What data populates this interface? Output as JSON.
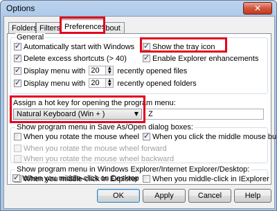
{
  "window": {
    "title": "Options",
    "close_glyph": "✕"
  },
  "tabs": [
    {
      "label": "Folders"
    },
    {
      "label": "Filters"
    },
    {
      "label": "Preferences"
    },
    {
      "label": "About"
    }
  ],
  "general": {
    "title": "General",
    "auto_start": {
      "label": "Automatically start with Windows",
      "checked": true
    },
    "show_tray": {
      "label": "Show the tray icon",
      "checked": true
    },
    "delete_shortcuts": {
      "label": "Delete excess shortcuts (> 40)",
      "checked": true
    },
    "explorer_enh": {
      "label": "Enable Explorer enhancements",
      "checked": true
    },
    "recent_files": {
      "prefix": "Display menu with",
      "value": "20",
      "suffix": "recently opened files",
      "checked": true
    },
    "recent_folders": {
      "prefix": "Display menu with",
      "value": "20",
      "suffix": "recently opened folders",
      "checked": true
    }
  },
  "hotkey": {
    "label": "Assign a hot key for opening the program menu:",
    "modifier": "Natural Keyboard (Win + )",
    "key": "Z"
  },
  "save_as": {
    "title": "Show program menu in Save As/Open dialog boxes:",
    "rotate_wheel": {
      "label": "When you rotate the mouse wheel",
      "checked": false
    },
    "middle_button": {
      "label": "When you click the middle mouse button",
      "checked": true
    },
    "rotate_forward": {
      "label": "When you rotate the mouse wheel forward",
      "checked": false
    },
    "rotate_backward": {
      "label": "When you rotate the mouse wheel backward",
      "checked": false
    }
  },
  "explorer": {
    "title": "Show program menu in Windows Explorer/Internet Explorer/Desktop:",
    "explorer_click": {
      "label": "When you middle-click in Explorer",
      "checked": true
    },
    "iexplorer_click": {
      "label": "When you middle-click in IExplorer",
      "checked": false
    },
    "desktop_click": {
      "label": "When you middle-click on Desktop",
      "checked": true
    }
  },
  "buttons": {
    "ok": "OK",
    "apply": "Apply",
    "cancel": "Cancel",
    "help": "Help"
  },
  "colors": {
    "highlight": "#e3001b",
    "window_frame": "#a9c6e8",
    "close_button": "#c23a20"
  }
}
